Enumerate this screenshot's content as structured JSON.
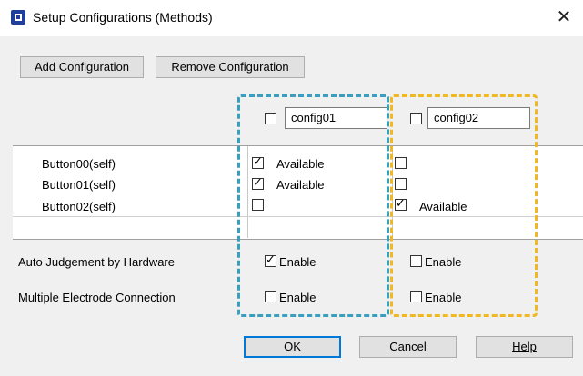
{
  "window": {
    "title": "Setup Configurations (Methods)",
    "close_label": "✕"
  },
  "toolbar": {
    "add_label": "Add Configuration",
    "remove_label": "Remove Configuration"
  },
  "configs": [
    {
      "name": "config01",
      "checked": false
    },
    {
      "name": "config02",
      "checked": false
    }
  ],
  "rows": [
    {
      "label": "Button00(self)",
      "c1_checked": true,
      "c1_text": "Available",
      "c2_checked": false,
      "c2_text": ""
    },
    {
      "label": "Button01(self)",
      "c1_checked": true,
      "c1_text": "Available",
      "c2_checked": false,
      "c2_text": ""
    },
    {
      "label": "Button02(self)",
      "c1_checked": false,
      "c1_text": "",
      "c2_checked": true,
      "c2_text": "Available"
    }
  ],
  "options": [
    {
      "label": "Auto Judgement by Hardware",
      "c1_checked": true,
      "c1_text": "Enable",
      "c2_checked": false,
      "c2_text": "Enable"
    },
    {
      "label": "Multiple Electrode Connection",
      "c1_checked": false,
      "c1_text": "Enable",
      "c2_checked": false,
      "c2_text": "Enable"
    }
  ],
  "footer": {
    "ok_label": "OK",
    "cancel_label": "Cancel",
    "help_label": "Help"
  },
  "colors": {
    "highlight_blue": "#3a9fbf",
    "highlight_yellow": "#f2b822",
    "focus_border": "#0078d7"
  }
}
